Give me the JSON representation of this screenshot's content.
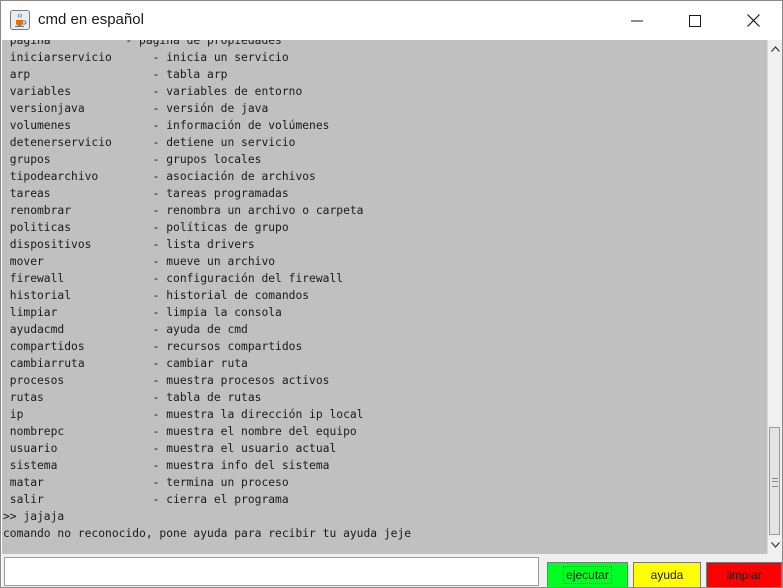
{
  "window": {
    "title": "cmd en español"
  },
  "console": {
    "lines": [
      " pagina           - pagina de propiedades",
      " iniciarservicio      - inicia un servicio",
      " arp                  - tabla arp",
      " variables            - variables de entorno",
      " versionjava          - versión de java",
      " volumenes            - información de volúmenes",
      " detenerservicio      - detiene un servicio",
      " grupos               - grupos locales",
      " tipodearchivo        - asociación de archivos",
      " tareas               - tareas programadas",
      " renombrar            - renombra un archivo o carpeta",
      " politicas            - políticas de grupo",
      " dispositivos         - lista drivers",
      " mover                - mueve un archivo",
      " firewall             - configuración del firewall",
      " historial            - historial de comandos",
      " limpiar              - limpia la consola",
      " ayudacmd             - ayuda de cmd",
      " compartidos          - recursos compartidos",
      " cambiarruta          - cambiar ruta",
      " procesos             - muestra procesos activos",
      " rutas                - tabla de rutas",
      " ip                   - muestra la dirección ip local",
      " nombrepc             - muestra el nombre del equipo",
      " usuario              - muestra el usuario actual",
      " sistema              - muestra info del sistema",
      " matar                - termina un proceso",
      " salir                - cierra el programa",
      ">> jajaja",
      "comando no reconocido, pone ayuda para recibir tu ayuda jeje"
    ]
  },
  "input": {
    "value": ""
  },
  "buttons": {
    "ejecutar": "ejecutar",
    "ayuda": "ayuda",
    "limpiar": "limpiar"
  },
  "colors": {
    "console_bg": "#c0c0c0",
    "ejecutar_bg": "#00ff22",
    "ayuda_bg": "#ffff00",
    "limpiar_bg": "#ff0000"
  },
  "icons": {
    "app": "java-cup-icon",
    "minimize": "minimize-icon",
    "maximize": "maximize-icon",
    "close": "close-icon",
    "scroll_up": "arrow-up-icon",
    "scroll_down": "arrow-down-icon"
  }
}
